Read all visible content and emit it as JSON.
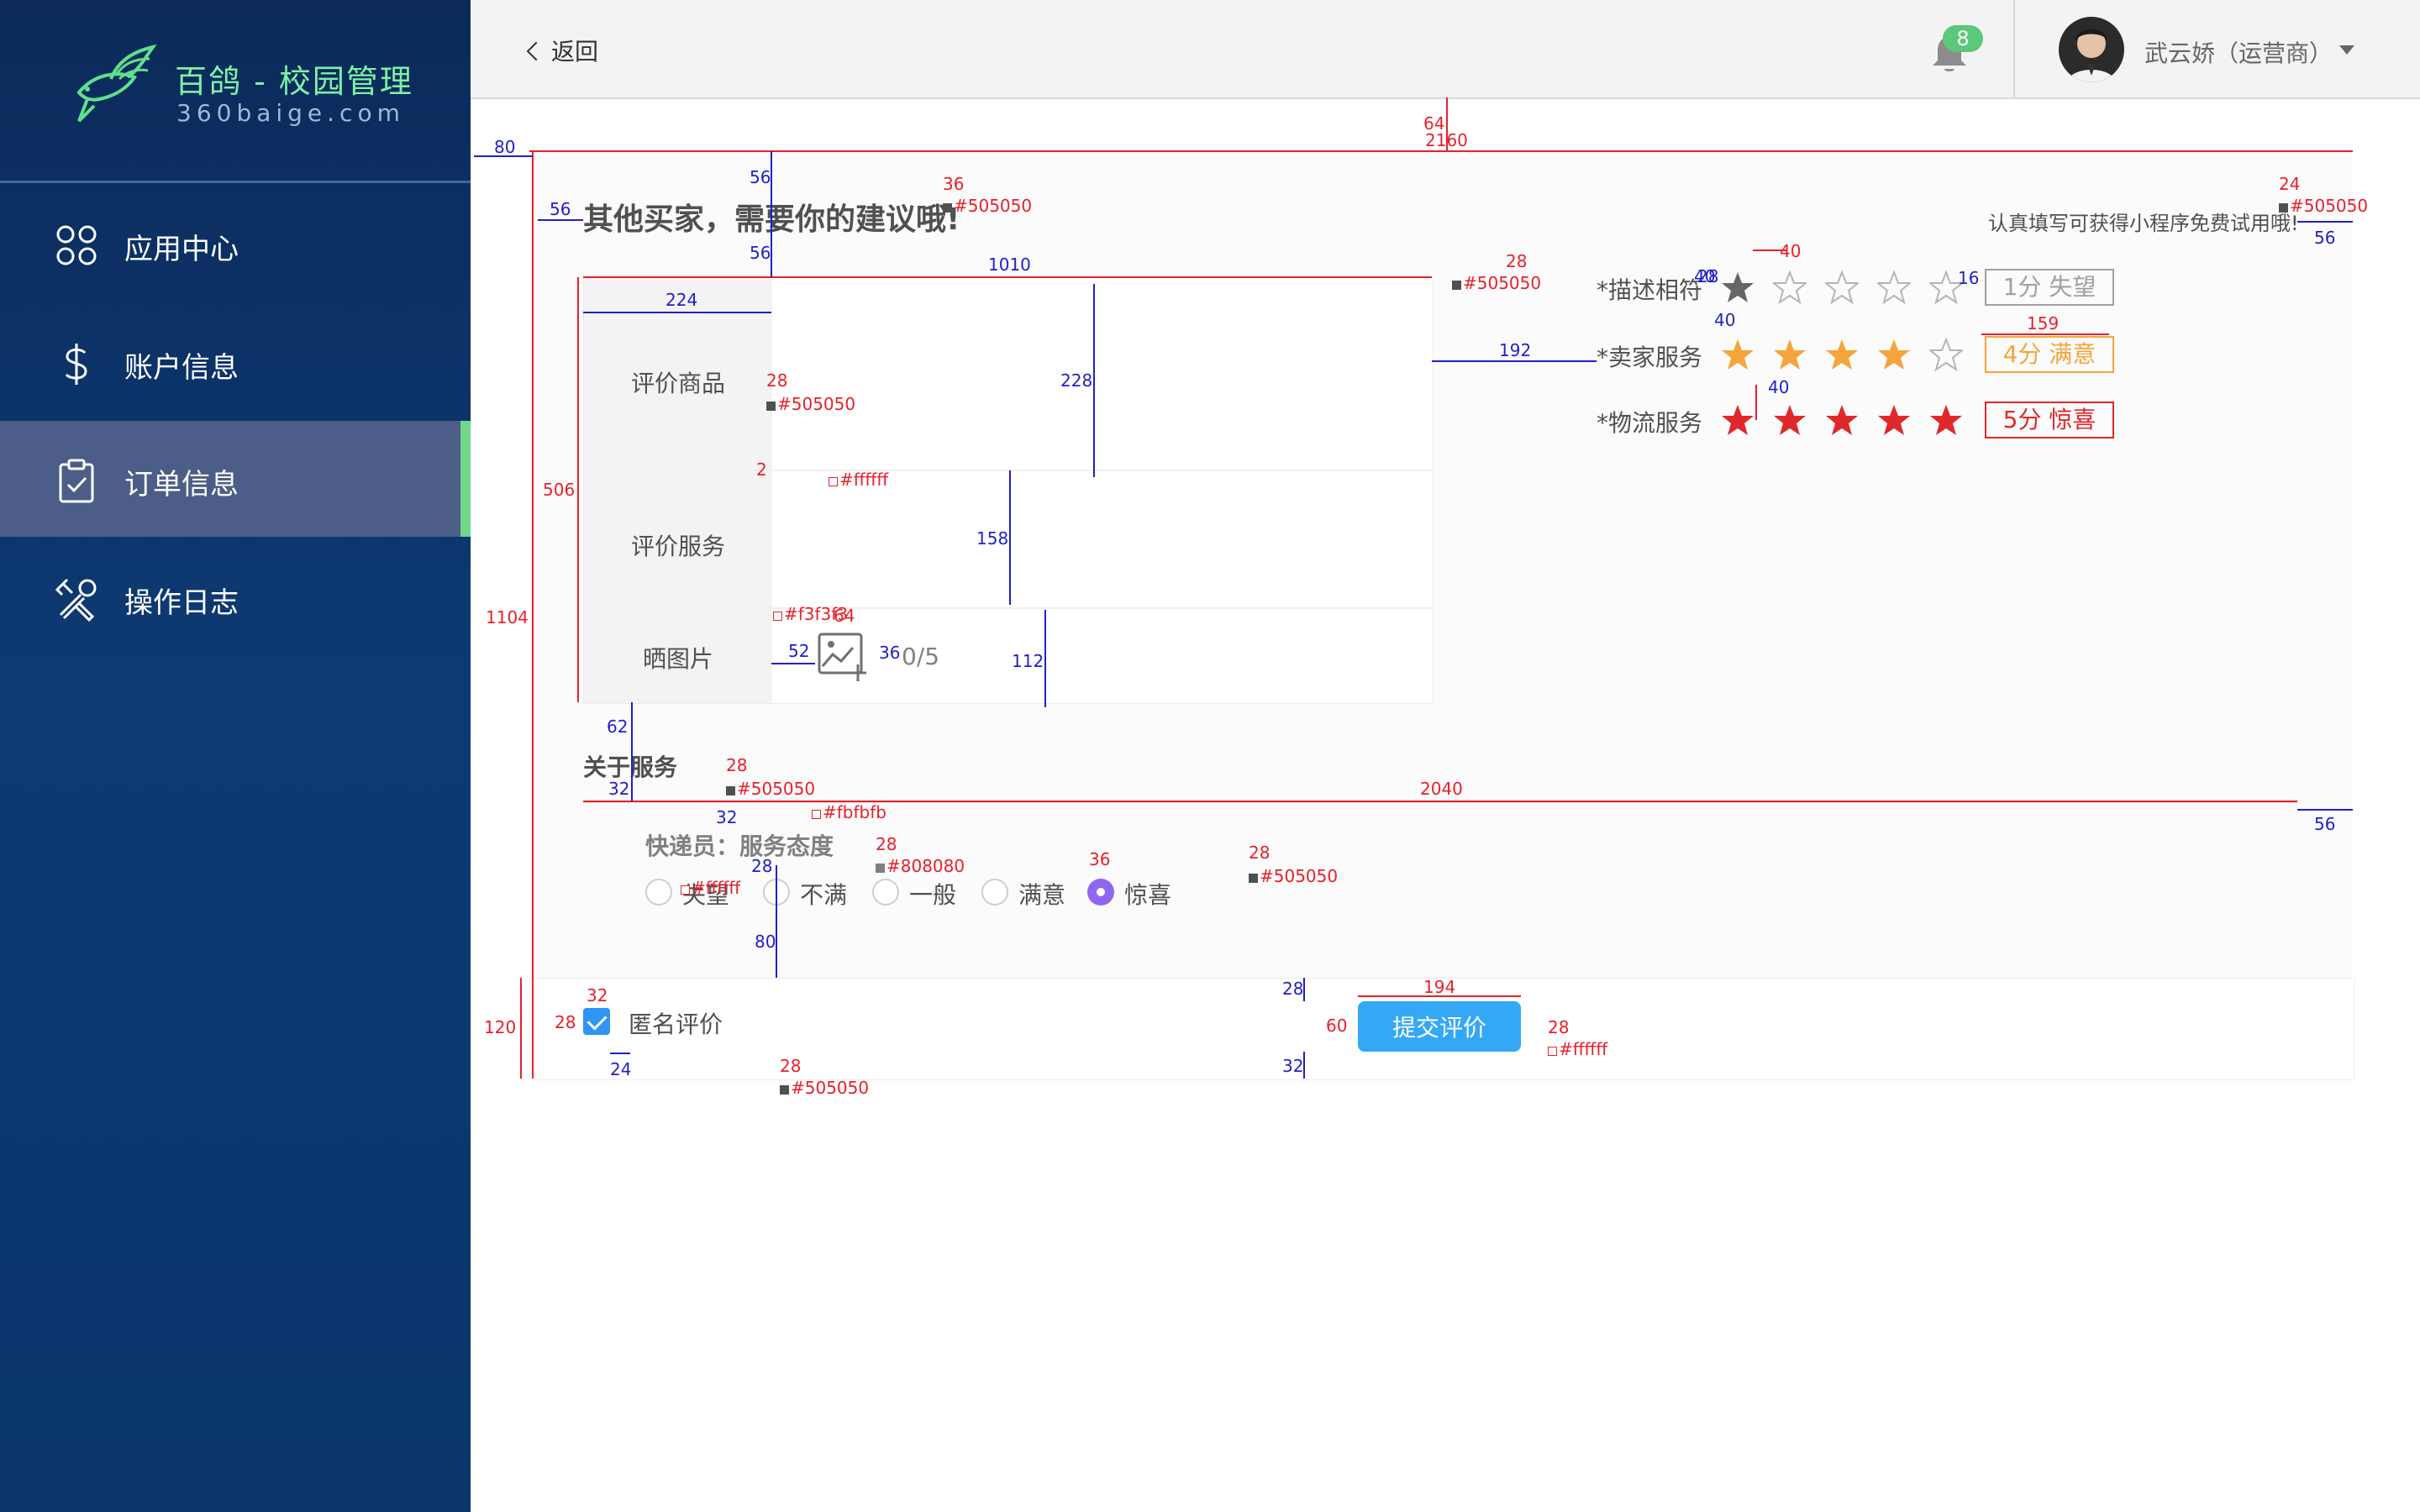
{
  "sidebar": {
    "logo_title": "百鸽 - 校园管理",
    "logo_sub": "360baige.com",
    "items": [
      {
        "label": "应用中心",
        "icon": "app-grid-icon",
        "active": false
      },
      {
        "label": "账户信息",
        "icon": "dollar-icon",
        "active": false
      },
      {
        "label": "订单信息",
        "icon": "clipboard-check-icon",
        "active": true
      },
      {
        "label": "操作日志",
        "icon": "tools-icon",
        "active": false
      }
    ],
    "accent": "#6fd68a"
  },
  "topbar": {
    "back_label": "返回",
    "notification_count": "8",
    "user": "武云娇（运营商）"
  },
  "form": {
    "heading": "其他买家，需要你的建议哦!",
    "tip": "认真填写可获得小程序免费试用哦!",
    "rows": [
      {
        "label": "评价商品"
      },
      {
        "label": "评价服务"
      },
      {
        "label": "晒图片"
      }
    ],
    "upload_count": "0/5",
    "ratings": [
      {
        "label": "*描述相符",
        "score": 1,
        "tag": "1分  失望",
        "color": "#a0a0a0"
      },
      {
        "label": "*卖家服务",
        "score": 4,
        "tag": "4分  满意",
        "color": "#f5a53b"
      },
      {
        "label": "*物流服务",
        "score": 5,
        "tag": "5分  惊喜",
        "color": "#e0282a"
      }
    ],
    "service_title": "关于服务",
    "courier_label": "快递员：服务态度",
    "options": [
      "失望",
      "不满",
      "一般",
      "满意",
      "惊喜"
    ],
    "selected_option": "惊喜",
    "anonymous_label": "匿名评价",
    "anonymous_checked": true,
    "submit_label": "提交评价"
  },
  "annotations": {
    "red": [
      "64",
      "2160",
      "36",
      "24",
      "28",
      "40",
      "159",
      "28",
      "2",
      "1104",
      "506",
      "28",
      "2040",
      "28",
      "36",
      "28",
      "32",
      "28",
      "28",
      "194",
      "60",
      "28",
      "120",
      "64"
    ],
    "blue": [
      "80",
      "56",
      "56",
      "56",
      "56",
      "1010",
      "224",
      "228",
      "192",
      "158",
      "112",
      "52",
      "36",
      "40",
      "40",
      "40",
      "16",
      "62",
      "32",
      "32",
      "28",
      "80",
      "28",
      "32",
      "24",
      "56",
      "28"
    ],
    "swatches": [
      "#505050",
      "#505050",
      "#505050",
      "#505050",
      "#ffffff",
      "#f3f3f3",
      "#505050",
      "#fbfbfb",
      "#808080",
      "#505050",
      "#ffffff",
      "#505050",
      "#ffffff"
    ]
  }
}
